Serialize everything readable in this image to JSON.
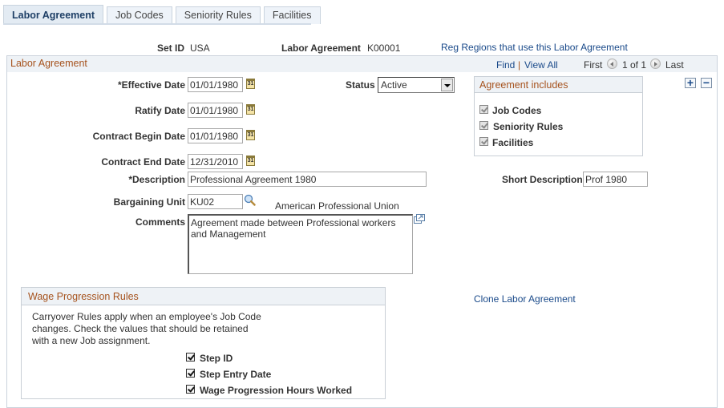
{
  "tabs": [
    {
      "label": "Labor Agreement",
      "active": true
    },
    {
      "label": "Job Codes",
      "active": false
    },
    {
      "label": "Seniority Rules",
      "active": false
    },
    {
      "label": "Facilities",
      "active": false
    }
  ],
  "header": {
    "setid_label": "Set ID",
    "setid_value": "USA",
    "agreement_label": "Labor Agreement",
    "agreement_value": "K00001",
    "reg_regions_link": "Reg Regions that use this Labor Agreement"
  },
  "frame": {
    "title": "Labor Agreement",
    "find": "Find",
    "separator": "|",
    "view_all": "View All",
    "first": "First",
    "page_info": "1 of 1",
    "last": "Last",
    "add_row": "+",
    "delete_row": "−"
  },
  "form": {
    "effective_date_label": "*Effective Date",
    "effective_date": "01/01/1980",
    "ratify_date_label": "Ratify Date",
    "ratify_date": "01/01/1980",
    "contract_begin_label": "Contract Begin Date",
    "contract_begin": "01/01/1980",
    "contract_end_label": "Contract End Date",
    "contract_end": "12/31/2010",
    "status_label": "Status",
    "status_value": "Active",
    "description_label": "*Description",
    "description": "Professional Agreement 1980",
    "short_description_label": "Short Description",
    "short_description": "Prof 1980",
    "bargaining_unit_label": "Bargaining Unit",
    "bargaining_unit": "KU02",
    "bargaining_unit_desc": "American Professional Union",
    "comments_label": "Comments",
    "comments": "Agreement made between Professional workers and Management",
    "calendar_glyph": "31"
  },
  "agreement_includes": {
    "title": "Agreement includes",
    "items": [
      {
        "label": "Job Codes",
        "checked": true
      },
      {
        "label": "Seniority Rules",
        "checked": true
      },
      {
        "label": "Facilities",
        "checked": true
      }
    ]
  },
  "wage_progression": {
    "title": "Wage Progression Rules",
    "description_lines": [
      "Carryover Rules apply when an employee's Job Code",
      "changes. Check the values that should be retained",
      "with a new Job assignment."
    ],
    "items": [
      {
        "label": "Step ID",
        "checked": true
      },
      {
        "label": "Step Entry Date",
        "checked": true
      },
      {
        "label": "Wage Progression Hours Worked",
        "checked": true
      }
    ]
  },
  "clone_link": "Clone Labor Agreement"
}
